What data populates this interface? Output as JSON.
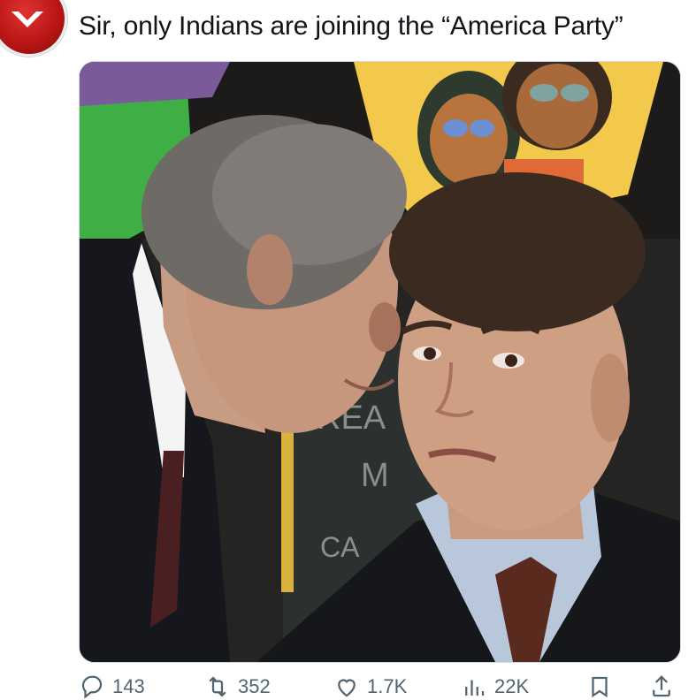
{
  "tweet": {
    "text": "Sir, only Indians are joining the “America Party”",
    "media": {
      "chalkboard_text": [
        "REA",
        "M",
        "CA"
      ]
    }
  },
  "actions": {
    "reply_count": "143",
    "repost_count": "352",
    "like_count": "1.7K",
    "views_count": "22K"
  },
  "icons": {
    "avatar": "avatar-red-logo",
    "reply": "reply-icon",
    "repost": "repost-icon",
    "like": "heart-icon",
    "views": "views-icon",
    "bookmark": "bookmark-icon",
    "share": "share-icon"
  },
  "colors": {
    "text": "#0f1419",
    "muted": "#536471",
    "border": "#cfd9de"
  }
}
